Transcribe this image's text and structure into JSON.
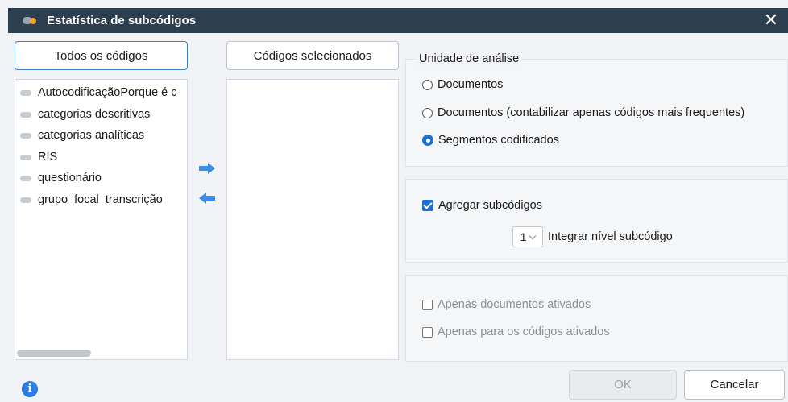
{
  "window": {
    "title": "Estatística de subcódigos",
    "close_symbol": "✕"
  },
  "tabs": {
    "all_codes": "Todos os códigos",
    "selected_codes": "Códigos selecionados"
  },
  "all_codes_list": [
    "AutocodificaçãoPorque é c",
    "categorias descritivas",
    "categorias analíticas",
    "RIS",
    "questionário",
    "grupo_focal_transcrição"
  ],
  "unit_group": {
    "legend": "Unidade de análise",
    "options": [
      {
        "label": "Documentos",
        "selected": false
      },
      {
        "label": "Documentos (contabilizar apenas códigos mais frequentes)",
        "selected": false
      },
      {
        "label": "Segmentos codificados",
        "selected": true
      }
    ]
  },
  "aggregate_group": {
    "aggregate_label": "Agregar subcódigos",
    "aggregate_checked": true,
    "level_value": "1",
    "level_label": "Integrar nível subcódigo"
  },
  "filter_group": {
    "only_active_docs": "Apenas documentos ativados",
    "only_active_codes": "Apenas para os códigos ativados"
  },
  "footer": {
    "info_symbol": "i",
    "ok": "OK",
    "cancel": "Cancelar"
  },
  "colors": {
    "titlebar": "#2d3e4f",
    "accent": "#1f6fd1",
    "arrow": "#3b8ee8"
  }
}
